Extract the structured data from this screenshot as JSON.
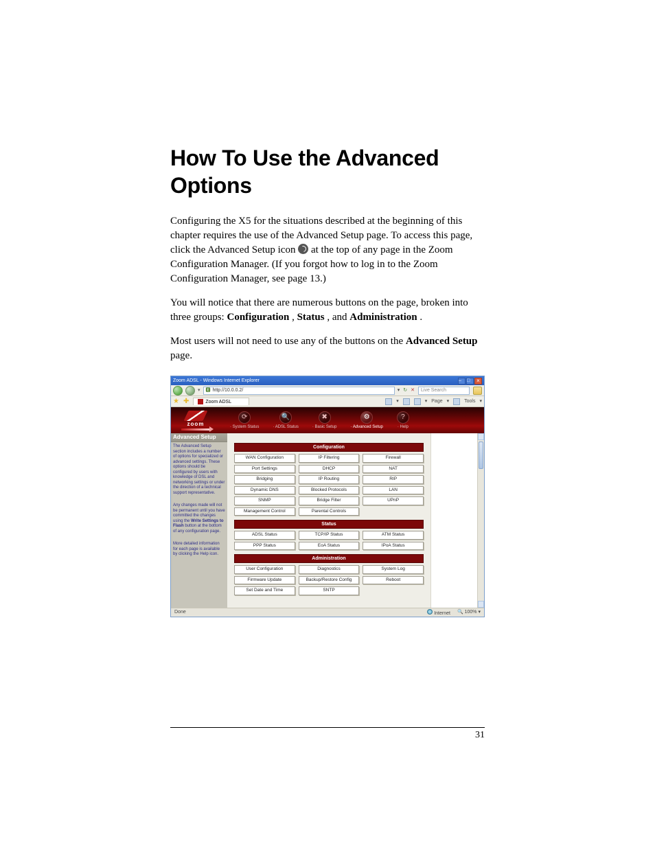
{
  "heading": "How To Use the Advanced Options",
  "para1_a": "Configuring the X5 for the situations described at the beginning of this chapter requires the use of the Advanced Setup page. To access this page, click the Advanced Setup icon ",
  "para1_b": " at the top of any page in the Zoom Configuration Manager. (If you forgot how to log in to the Zoom Configuration Manager, see page 13.)",
  "para2_a": "You will notice that there are numerous buttons on the page, broken into three groups: ",
  "para2_b": "Configuration",
  "para2_c": ", ",
  "para2_d": "Status",
  "para2_e": ", and ",
  "para2_f": "Administration",
  "para2_g": ".",
  "para3_a": "Most users will not need to use any of the buttons on the ",
  "para3_b": "Advanced Setup",
  "para3_c": " page.",
  "page_number": "31",
  "ie": {
    "title": "Zoom ADSL - Windows Internet Explorer",
    "url": "http://10.0.0.2/",
    "search_placeholder": "Live Search",
    "tab_label": "Zoom ADSL",
    "toolbar_page": "Page",
    "toolbar_tools": "Tools",
    "status_done": "Done",
    "status_zone": "Internet",
    "status_zoom": "100%"
  },
  "zoom": {
    "brand": "zoom",
    "nav": [
      "· System Status",
      "· ADSL Status",
      "· Basic Setup",
      "· Advanced Setup",
      "· Help"
    ]
  },
  "sidebar": {
    "title": "Advanced Setup",
    "p1_a": "The Advanced Setup section includes a number of options for specialized or advanced settings. These options should be configured by users with knowledge of DSL and networking settings or under the direction of a technical support representative.",
    "p2_a": "Any changes made will not be permanent until you have committed the changes using the ",
    "p2_b": "Write Settings to Flash",
    "p2_c": " button at the bottom of any configuration page.",
    "p3": "More detailed information for each page is available by clicking the Help icon."
  },
  "sections": {
    "config_title": "Configuration",
    "status_title": "Status",
    "admin_title": "Administration"
  },
  "config_buttons": [
    "WAN Configuration",
    "IP Filtering",
    "Firewall",
    "Port Settings",
    "DHCP",
    "NAT",
    "Bridging",
    "IP Routing",
    "RIP",
    "Dynamic DNS",
    "Blocked Protocols",
    "LAN",
    "SNMP",
    "Bridge Filter",
    "UPnP",
    "Management Control",
    "Parental Controls"
  ],
  "status_buttons": [
    "ADSL Status",
    "TCP/IP Status",
    "ATM Status",
    "PPP Status",
    "EoA Status",
    "IPoA Status"
  ],
  "admin_buttons": [
    "User Configuration",
    "Diagnostics",
    "System Log",
    "Firmware Update",
    "Backup/Restore Config",
    "Reboot",
    "Set Date and Time",
    "SNTP"
  ]
}
